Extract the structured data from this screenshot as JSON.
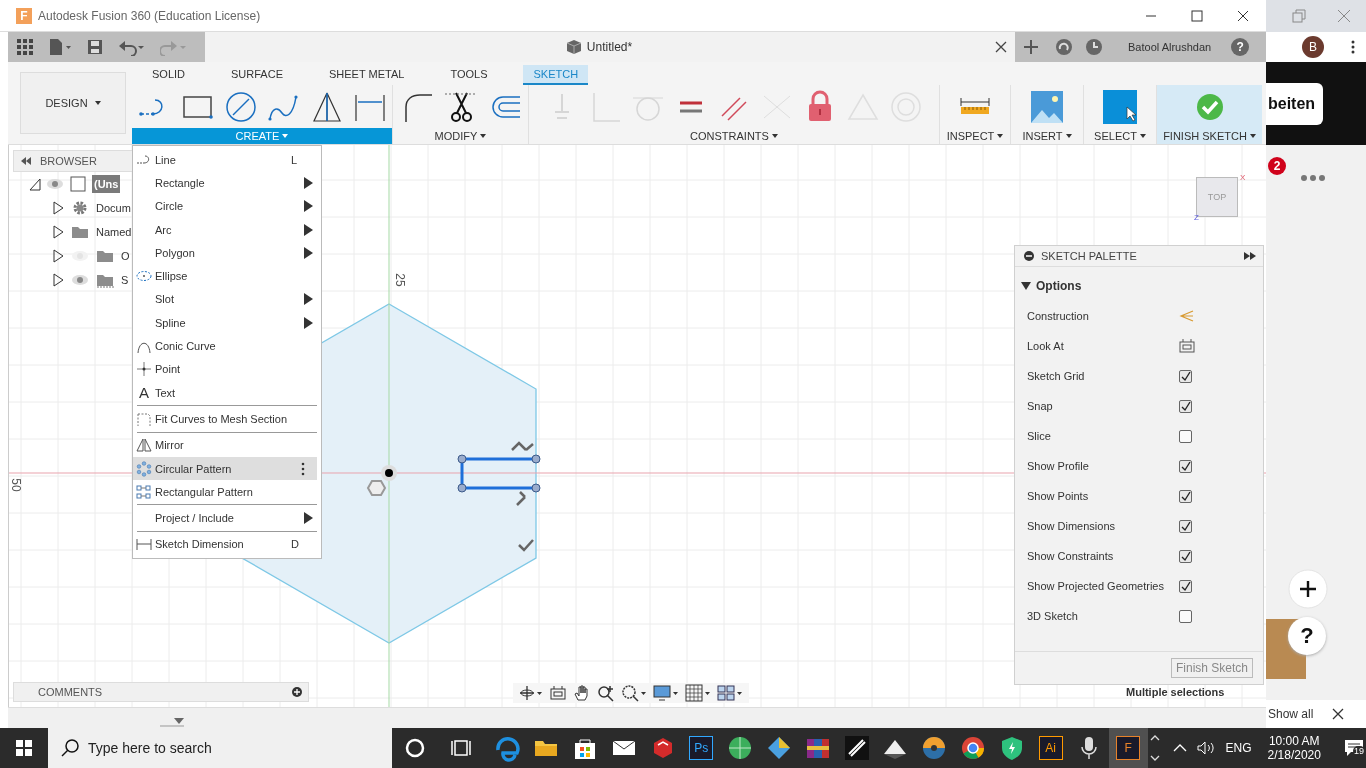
{
  "window": {
    "logo": "F",
    "title": "Autodesk Fusion 360 (Education License)"
  },
  "document_tab": {
    "title": "Untitled*"
  },
  "user": {
    "name": "Batool Alrushdan",
    "help": "?"
  },
  "workspace": {
    "label": "DESIGN"
  },
  "toolbar_tabs": [
    {
      "label": "SOLID",
      "selected": false
    },
    {
      "label": "SURFACE",
      "selected": false
    },
    {
      "label": "SHEET METAL",
      "selected": false
    },
    {
      "label": "TOOLS",
      "selected": false
    },
    {
      "label": "SKETCH",
      "selected": true
    }
  ],
  "tool_groups": [
    {
      "kind": "create",
      "label": "CREATE",
      "expanded": true
    },
    {
      "kind": "modify",
      "label": "MODIFY",
      "expanded": false
    },
    {
      "kind": "constraints",
      "label": "CONSTRAINTS",
      "expanded": false
    },
    {
      "kind": "inspect",
      "label": "INSPECT",
      "expanded": false
    },
    {
      "kind": "insert",
      "label": "INSERT",
      "expanded": false
    },
    {
      "kind": "select",
      "label": "SELECT",
      "expanded": false
    },
    {
      "kind": "finish",
      "label": "FINISH SKETCH",
      "expanded": false
    }
  ],
  "browser": {
    "title": "BROWSER",
    "tree": [
      {
        "kind": "component",
        "label": "(Uns",
        "expanded": true,
        "visible": true,
        "selected": true,
        "children": [
          {
            "kind": "settings",
            "label": "Docum",
            "expanded": false,
            "selected": false
          },
          {
            "kind": "folder",
            "label": "Named",
            "expanded": false,
            "selected": false
          },
          {
            "kind": "folder",
            "label": "O",
            "expanded": false,
            "visible": false,
            "selected": false
          },
          {
            "kind": "sketches",
            "label": "S",
            "expanded": false,
            "visible": true,
            "selected": false
          }
        ]
      }
    ]
  },
  "create_menu": {
    "groups": [
      [
        {
          "kind": "line",
          "label": "Line",
          "shortcut": "L",
          "submenu": false,
          "selected": false
        },
        {
          "kind": "plain",
          "label": "Rectangle",
          "submenu": true,
          "selected": false
        },
        {
          "kind": "plain",
          "label": "Circle",
          "submenu": true,
          "selected": false
        },
        {
          "kind": "plain",
          "label": "Arc",
          "submenu": true,
          "selected": false
        },
        {
          "kind": "plain",
          "label": "Polygon",
          "submenu": true,
          "selected": false
        },
        {
          "kind": "ellipse",
          "label": "Ellipse",
          "submenu": false,
          "selected": false
        },
        {
          "kind": "plain",
          "label": "Slot",
          "submenu": true,
          "selected": false
        },
        {
          "kind": "plain",
          "label": "Spline",
          "submenu": true,
          "selected": false
        },
        {
          "kind": "conic",
          "label": "Conic Curve",
          "submenu": false,
          "selected": false
        },
        {
          "kind": "point",
          "label": "Point",
          "submenu": false,
          "selected": false
        },
        {
          "kind": "glyph",
          "glyph": "A",
          "label": "Text",
          "submenu": false,
          "selected": false
        }
      ],
      [
        {
          "kind": "fit",
          "label": "Fit Curves to Mesh Section",
          "submenu": false,
          "selected": false
        }
      ],
      [
        {
          "kind": "mirror",
          "label": "Mirror",
          "submenu": false,
          "selected": false
        },
        {
          "kind": "circular",
          "label": "Circular Pattern",
          "submenu": false,
          "selected": true
        },
        {
          "kind": "rectangular",
          "label": "Rectangular Pattern",
          "submenu": false,
          "selected": false
        }
      ],
      [
        {
          "kind": "plain",
          "label": "Project / Include",
          "submenu": true,
          "selected": false
        }
      ],
      [
        {
          "kind": "dimension",
          "label": "Sketch Dimension",
          "shortcut": "D",
          "submenu": false,
          "selected": false
        }
      ]
    ]
  },
  "canvas": {
    "axis_labels": [
      {
        "kind": "vertical",
        "text": "25"
      },
      {
        "kind": "horizontal",
        "text": "50"
      }
    ]
  },
  "view_cube": {
    "face": "TOP",
    "axes": [
      {
        "kind": "x",
        "text": "X"
      },
      {
        "kind": "z",
        "text": "Z"
      }
    ]
  },
  "sketch_palette": {
    "title": "SKETCH PALETTE",
    "section": {
      "label": "Options",
      "expanded": true
    },
    "options": [
      {
        "kind": "construction",
        "label": "Construction"
      },
      {
        "kind": "look_at",
        "label": "Look At"
      },
      {
        "kind": "checkbox",
        "label": "Sketch Grid",
        "checked": true
      },
      {
        "kind": "checkbox",
        "label": "Snap",
        "checked": true
      },
      {
        "kind": "checkbox",
        "label": "Slice",
        "checked": false
      },
      {
        "kind": "checkbox",
        "label": "Show Profile",
        "checked": true
      },
      {
        "kind": "checkbox",
        "label": "Show Points",
        "checked": true
      },
      {
        "kind": "checkbox",
        "label": "Show Dimensions",
        "checked": true
      },
      {
        "kind": "checkbox",
        "label": "Show Constraints",
        "checked": true
      },
      {
        "kind": "checkbox",
        "label": "Show Projected Geometries",
        "checked": true
      },
      {
        "kind": "checkbox",
        "label": "3D Sketch",
        "checked": false
      }
    ],
    "button": "Finish Sketch"
  },
  "comments": {
    "title": "COMMENTS"
  },
  "selection_info": "Multiple selections",
  "background_window": {
    "avatar": "B",
    "button": "beiten",
    "badge": "2",
    "help": "?",
    "link": "Show all"
  },
  "taskbar": {
    "search_placeholder": "Type here to search",
    "apps": [
      {
        "kind": "swirl",
        "selected": false
      },
      {
        "kind": "folder",
        "selected": false
      },
      {
        "kind": "bag",
        "selected": false
      },
      {
        "kind": "mail",
        "selected": false
      },
      {
        "kind": "sketchup",
        "selected": false
      },
      {
        "kind": "label",
        "label": "Ps",
        "color": "#31a8ff",
        "selected": false
      },
      {
        "kind": "globe",
        "selected": false
      },
      {
        "kind": "diamond",
        "selected": false
      },
      {
        "kind": "books",
        "selected": false
      },
      {
        "kind": "pen",
        "selected": false
      },
      {
        "kind": "mountain",
        "selected": false
      },
      {
        "kind": "disc",
        "selected": false
      },
      {
        "kind": "chrome",
        "selected": false
      },
      {
        "kind": "shield",
        "selected": false
      },
      {
        "kind": "label",
        "label": "Ai",
        "color": "#ff9a00",
        "selected": false
      },
      {
        "kind": "mic",
        "selected": false
      },
      {
        "kind": "label",
        "label": "F",
        "color": "#e8822a",
        "selected": true
      }
    ],
    "tray": {
      "language": "ENG",
      "time": "10:00 AM",
      "date": "2/18/2020",
      "notifications": "19"
    }
  }
}
